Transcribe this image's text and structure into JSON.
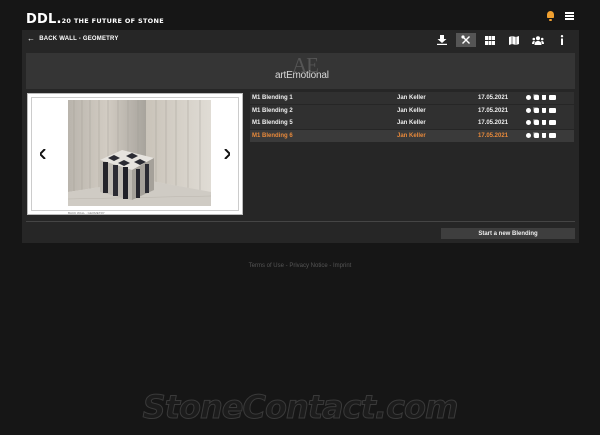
{
  "header": {
    "logo": "DDL.",
    "tagline": "20 THE FUTURE OF STONE",
    "accent_color": "#f0a030",
    "icons": [
      "bell-icon",
      "menu-icon"
    ]
  },
  "panel": {
    "back_label": "BACK WALL - GEOMETRY",
    "toolbar": [
      {
        "name": "download-icon",
        "active": false
      },
      {
        "name": "tools-icon",
        "active": true
      },
      {
        "name": "grid-icon",
        "active": false
      },
      {
        "name": "map-icon",
        "active": false
      },
      {
        "name": "users-icon",
        "active": false
      },
      {
        "name": "info-icon",
        "active": false
      }
    ]
  },
  "brand_banner": {
    "monogram": "AE",
    "wordmark": "artEmotional"
  },
  "viewer": {
    "caption": "BACK WALL · GEOMETRY"
  },
  "blendings": [
    {
      "name": "M1 Blending 1",
      "user": "Jan Keller",
      "date": "17.05.2021",
      "highlighted": false
    },
    {
      "name": "M1 Blending 2",
      "user": "Jan Keller",
      "date": "17.05.2021",
      "highlighted": false
    },
    {
      "name": "M1 Blending 5",
      "user": "Jan Keller",
      "date": "17.05.2021",
      "highlighted": false
    },
    {
      "name": "M1 Blending 6",
      "user": "Jan Keller",
      "date": "17.05.2021",
      "highlighted": true
    }
  ],
  "highlight_color": "#e8893a",
  "actions": {
    "new_blending_label": "Start a new Blending"
  },
  "footer": {
    "terms": "Terms of Use",
    "privacy": "Privacy Notice",
    "imprint": "Imprint",
    "separator": " - "
  },
  "watermark": "StoneContact.com"
}
